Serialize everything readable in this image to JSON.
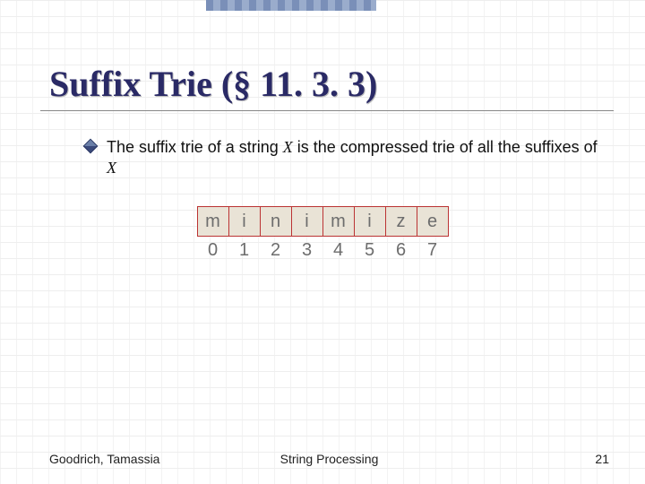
{
  "title": "Suffix Trie (§ 11. 3. 3)",
  "bullet": {
    "pre": "The suffix trie of a string ",
    "var1": "X",
    "mid": " is the compressed trie of all the suffixes of ",
    "var2": "X"
  },
  "diagram": {
    "letters": [
      "m",
      "i",
      "n",
      "i",
      "m",
      "i",
      "z",
      "e"
    ],
    "indices": [
      "0",
      "1",
      "2",
      "3",
      "4",
      "5",
      "6",
      "7"
    ]
  },
  "footer": {
    "left": "Goodrich, Tamassia",
    "center": "String Processing",
    "right": "21"
  }
}
